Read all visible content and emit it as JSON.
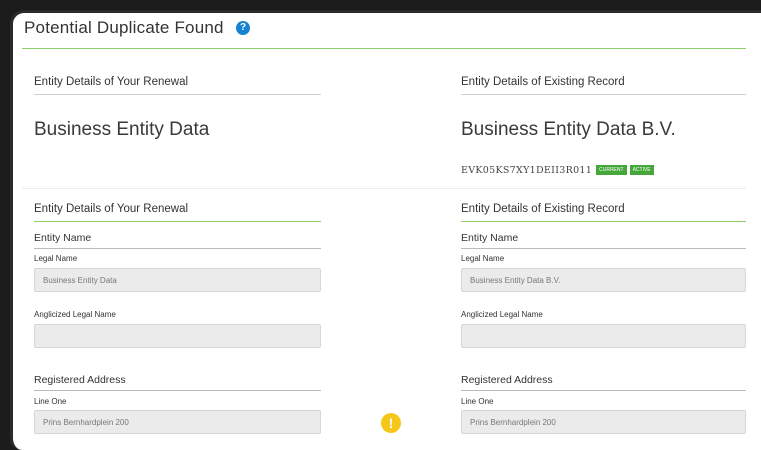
{
  "header": {
    "title": "Potential Duplicate Found",
    "help_icon": "question-circle-icon"
  },
  "left_top": {
    "heading": "Entity Details of Your Renewal",
    "entity_name": "Business Entity Data"
  },
  "right_top": {
    "heading": "Entity Details of Existing Record",
    "entity_name": "Business Entity Data B.V.",
    "lei_code": "EVK05KS7XY1DEII3R011",
    "badges": [
      "CURRENT",
      "ACTIVE"
    ]
  },
  "left_detail": {
    "heading": "Entity Details of Your Renewal",
    "entity_name_group": "Entity Name",
    "legal_name_label": "Legal Name",
    "legal_name_value": "Business Entity Data",
    "anglicized_label": "Anglicized Legal Name",
    "anglicized_value": "",
    "address_group": "Registered Address",
    "line_one_label": "Line One",
    "line_one_value": "Prins Bernhardplein 200"
  },
  "right_detail": {
    "heading": "Entity Details of Existing Record",
    "entity_name_group": "Entity Name",
    "legal_name_label": "Legal Name",
    "legal_name_value": "Business Entity Data B.V.",
    "anglicized_label": "Anglicized Legal Name",
    "anglicized_value": "",
    "address_group": "Registered Address",
    "line_one_label": "Line One",
    "line_one_value": "Prins Bernhardplein 200"
  },
  "warning_icon": "exclamation-circle-icon",
  "colors": {
    "accent_green": "#8fcf67",
    "badge_green": "#45a63a",
    "help_blue": "#1583d1",
    "warning_yellow": "#f6c71a"
  }
}
